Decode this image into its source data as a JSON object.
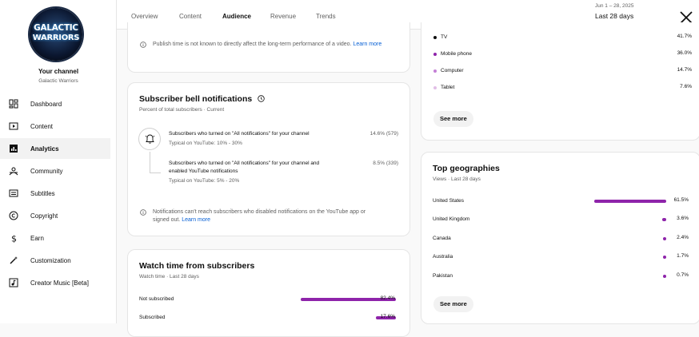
{
  "sidebar": {
    "logo_line1": "GALACTIC",
    "logo_line2": "WARRIORS",
    "title": "Your channel",
    "channel_name": "Galactic Warriors",
    "items": [
      {
        "label": "Dashboard",
        "icon": "dashboard-icon"
      },
      {
        "label": "Content",
        "icon": "content-icon"
      },
      {
        "label": "Analytics",
        "icon": "analytics-icon"
      },
      {
        "label": "Community",
        "icon": "community-icon"
      },
      {
        "label": "Subtitles",
        "icon": "subtitles-icon"
      },
      {
        "label": "Copyright",
        "icon": "copyright-icon"
      },
      {
        "label": "Earn",
        "icon": "earn-icon"
      },
      {
        "label": "Customization",
        "icon": "customization-icon"
      },
      {
        "label": "Creator Music [Beta]",
        "icon": "creator-music-icon"
      }
    ],
    "active_item": "Analytics"
  },
  "tabs": [
    "Overview",
    "Content",
    "Audience",
    "Revenue",
    "Trends"
  ],
  "active_tab": "Audience",
  "header": {
    "date_range": "Jun 1 – 28, 2025",
    "period_label": "Last 28 days"
  },
  "publish_note": {
    "text": "Publish time is not known to directly affect the long-term performance of a video.",
    "link": "Learn more"
  },
  "bell": {
    "title": "Subscriber bell notifications",
    "subtitle": "Percent of total subscribers · Current",
    "rows": [
      {
        "line1": "Subscribers who turned on \"All notifications\" for your channel",
        "typical": "Typical on YouTube: 10% - 30%",
        "value": "14.6% (579)"
      },
      {
        "line1": "Subscribers who turned on \"All notifications\" for your channel and",
        "line2": "enabled YouTube notifications",
        "typical": "Typical on YouTube: 5% - 20%",
        "value": "8.5% (339)"
      }
    ],
    "note": "Notifications can't reach subscribers who disabled notifications on the YouTube app or",
    "note2": "signed out.",
    "note_link": "Learn more"
  },
  "watch_time": {
    "title": "Watch time from subscribers",
    "subtitle": "Watch time · Last 28 days",
    "rows": [
      {
        "label": "Not subscribed",
        "value": "82.4%",
        "fraction": 0.824
      },
      {
        "label": "Subscribed",
        "value": "17.6%",
        "fraction": 0.176
      }
    ]
  },
  "devices": {
    "rows": [
      {
        "label": "TV",
        "value": "41.7%",
        "color": "#0f0f0f"
      },
      {
        "label": "Mobile phone",
        "value": "36.0%",
        "color": "#8e24aa"
      },
      {
        "label": "Computer",
        "value": "14.7%",
        "color": "#c47fd6"
      },
      {
        "label": "Tablet",
        "value": "7.6%",
        "color": "#e1bee7"
      }
    ],
    "see_more": "See more"
  },
  "geographies": {
    "title": "Top geographies",
    "subtitle": "Views · Last 28 days",
    "rows": [
      {
        "label": "United States",
        "value": "61.5%",
        "fraction": 0.615
      },
      {
        "label": "United Kingdom",
        "value": "3.6%",
        "fraction": 0.036
      },
      {
        "label": "Canada",
        "value": "2.4%",
        "fraction": 0.024
      },
      {
        "label": "Australia",
        "value": "1.7%",
        "fraction": 0.017
      },
      {
        "label": "Pakistan",
        "value": "0.7%",
        "fraction": 0.007
      }
    ],
    "see_more": "See more"
  },
  "colors": {
    "accent": "#8e24aa",
    "link": "#065fd4"
  }
}
